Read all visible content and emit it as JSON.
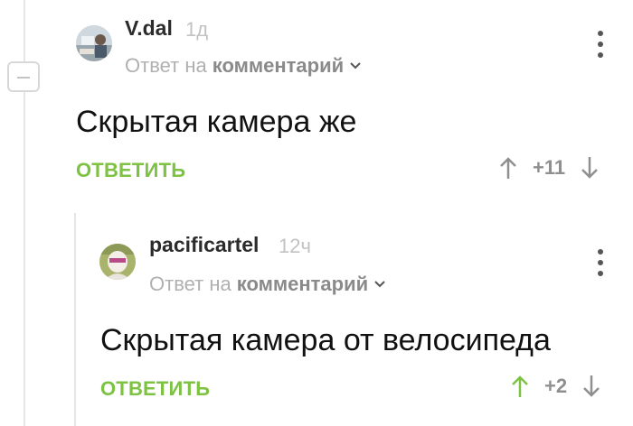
{
  "comments": [
    {
      "username": "V.dal",
      "time": "1д",
      "reply_prefix": "Ответ на",
      "reply_link": "комментарий",
      "text": "Скрытая камера же",
      "reply_label": "ОТВЕТИТЬ",
      "rating": "+11",
      "upvoted": false
    },
    {
      "username": "pacificartel",
      "time": "12ч",
      "reply_prefix": "Ответ на",
      "reply_link": "комментарий",
      "text": "Скрытая камера от велосипеда",
      "reply_label": "ОТВЕТИТЬ",
      "rating": "+2",
      "upvoted": true
    }
  ],
  "colors": {
    "accent_green": "#7dc243",
    "vote_gray": "#8f8f8f"
  },
  "icons": {
    "collapse": "minus-icon",
    "more": "more-vertical-icon",
    "upvote": "arrow-up-icon",
    "downvote": "arrow-down-icon",
    "expand": "chevron-down-icon"
  }
}
